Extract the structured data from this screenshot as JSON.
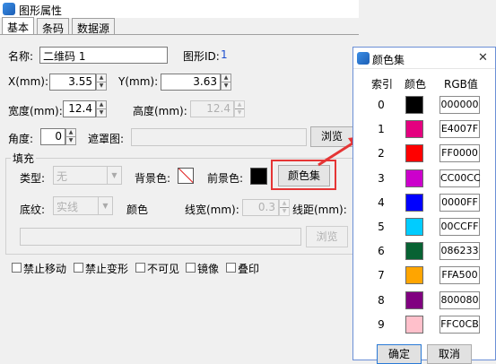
{
  "window": {
    "title": "图形属性"
  },
  "tabs": [
    {
      "label": "基本"
    },
    {
      "label": "条码"
    },
    {
      "label": "数据源"
    }
  ],
  "form": {
    "name_label": "名称:",
    "name_value": "二维码 1",
    "id_label": "图形ID:",
    "id_value": "1",
    "x_label": "X(mm):",
    "x_value": "3.55",
    "y_label": "Y(mm):",
    "y_value": "3.63",
    "width_label": "宽度(mm):",
    "width_value": "12.4",
    "height_label": "高度(mm):",
    "height_value": "12.4",
    "angle_label": "角度:",
    "angle_value": "0",
    "mask_label": "遮罩图:",
    "mask_browse": "浏览"
  },
  "fill": {
    "group_label": "填充",
    "type_label": "类型:",
    "type_value": "无",
    "bg_label": "背景色:",
    "fg_label": "前景色:",
    "fg_color": "#000000",
    "colorset_button": "颜色集",
    "texture_label": "底纹:",
    "texture_value": "实线",
    "color_label": "颜色",
    "linewidth_label": "线宽(mm):",
    "linewidth_value": "0.3",
    "linespacing_label": "线距(mm):",
    "browse_button": "浏览"
  },
  "options": [
    {
      "label": "禁止移动"
    },
    {
      "label": "禁止变形"
    },
    {
      "label": "不可见"
    },
    {
      "label": "镜像"
    },
    {
      "label": "叠印"
    }
  ],
  "color_dialog": {
    "title": "颜色集",
    "close_glyph": "✕",
    "col_index": "索引",
    "col_color": "颜色",
    "col_rgb": "RGB值",
    "rows": [
      {
        "index": "0",
        "rgb": "000000",
        "color": "#000000"
      },
      {
        "index": "1",
        "rgb": "E4007F",
        "color": "#E4007F"
      },
      {
        "index": "2",
        "rgb": "FF0000",
        "color": "#FF0000"
      },
      {
        "index": "3",
        "rgb": "CC00CC",
        "color": "#CC00CC"
      },
      {
        "index": "4",
        "rgb": "0000FF",
        "color": "#0000FF"
      },
      {
        "index": "5",
        "rgb": "00CCFF",
        "color": "#00CCFF"
      },
      {
        "index": "6",
        "rgb": "086233",
        "color": "#086233"
      },
      {
        "index": "7",
        "rgb": "FFA500",
        "color": "#FFA500"
      },
      {
        "index": "8",
        "rgb": "800080",
        "color": "#800080"
      },
      {
        "index": "9",
        "rgb": "FFC0CB",
        "color": "#FFC0CB"
      }
    ],
    "ok_button": "确定",
    "cancel_button": "取消"
  },
  "colors": {
    "annotation_red": "#E53535",
    "dialog_border": "#6B8FD6",
    "id_blue": "#1E4FCF"
  }
}
